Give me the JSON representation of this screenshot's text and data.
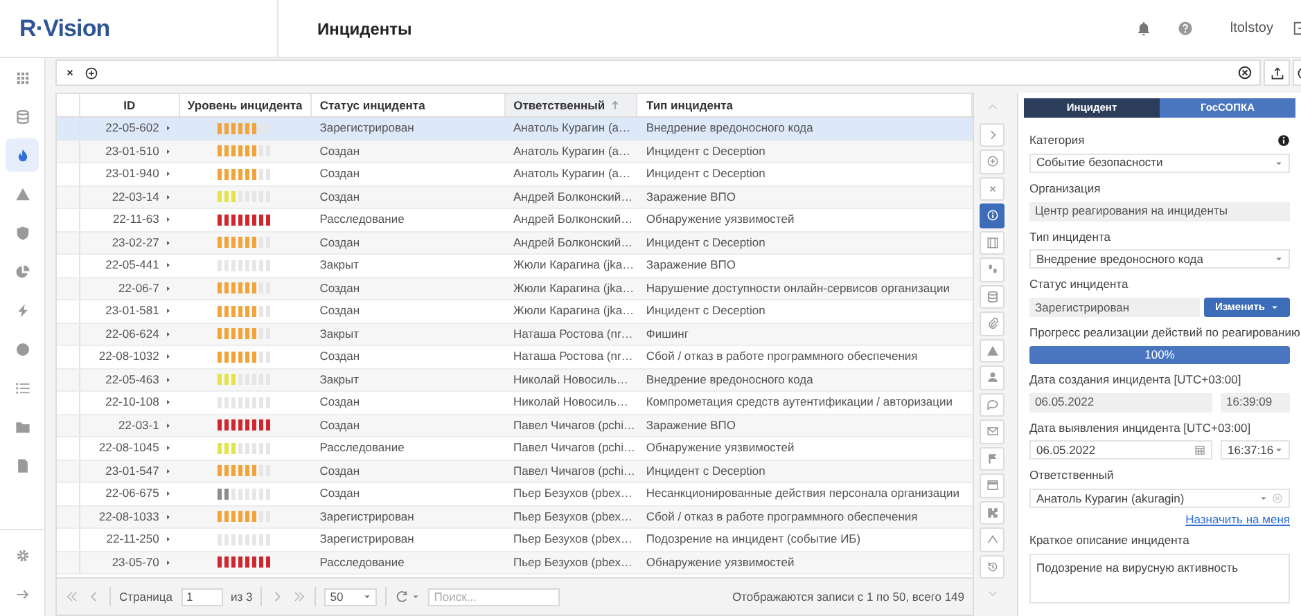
{
  "header": {
    "logo": "R·Vision",
    "title": "Инциденты",
    "user": "ltolstoy"
  },
  "sidebar": {
    "items": [
      {
        "kind": "grid",
        "selected": false
      },
      {
        "kind": "database",
        "selected": false
      },
      {
        "kind": "flame",
        "selected": true
      },
      {
        "kind": "warning",
        "selected": false
      },
      {
        "kind": "shield",
        "selected": false
      },
      {
        "kind": "pie",
        "selected": false
      },
      {
        "kind": "bolt",
        "selected": false
      },
      {
        "kind": "alert",
        "selected": false
      },
      {
        "kind": "list",
        "selected": false
      },
      {
        "kind": "folder",
        "selected": false
      },
      {
        "kind": "document",
        "selected": false
      }
    ],
    "bottom_items": [
      {
        "kind": "gear",
        "selected": false
      },
      {
        "kind": "arrow",
        "selected": false
      }
    ]
  },
  "table": {
    "columns": [
      {
        "label": "ID",
        "sorted": false
      },
      {
        "label": "Уровень инцидента",
        "sorted": false
      },
      {
        "label": "Статус инцидента",
        "sorted": false
      },
      {
        "label": "Ответственный",
        "sorted": true
      },
      {
        "label": "Тип инцидента",
        "sorted": false
      }
    ],
    "rows": [
      {
        "id": "22-05-602",
        "level": 0.75,
        "color": "#f2a33a",
        "status": "Зарегистрирован",
        "owner": "Анатоль Курагин (а…",
        "type": "Внедрение вредоносного кода",
        "selected": true
      },
      {
        "id": "23-01-510",
        "level": 0.75,
        "color": "#f2a33a",
        "status": "Создан",
        "owner": "Анатоль Курагин (а…",
        "type": "Инцидент с Deception",
        "selected": false
      },
      {
        "id": "23-01-940",
        "level": 0.75,
        "color": "#f2a33a",
        "status": "Создан",
        "owner": "Анатоль Курагин (а…",
        "type": "Инцидент с Deception",
        "selected": false
      },
      {
        "id": "22-03-14",
        "level": 0.375,
        "color": "#e3e34a",
        "status": "Создан",
        "owner": "Андрей Болконский…",
        "type": "Заражение ВПО",
        "selected": false
      },
      {
        "id": "22-11-63",
        "level": 1,
        "color": "#d0262e",
        "status": "Расследование",
        "owner": "Андрей Болконский…",
        "type": "Обнаружение уязвимостей",
        "selected": false
      },
      {
        "id": "23-02-27",
        "level": 0.75,
        "color": "#f2a33a",
        "status": "Создан",
        "owner": "Андрей Болконский…",
        "type": "Инцидент с Deception",
        "selected": false
      },
      {
        "id": "22-05-441",
        "level": 0,
        "status": "Закрыт",
        "owner": "Жюли Карагина (jka…",
        "type": "Заражение ВПО",
        "selected": false
      },
      {
        "id": "22-06-7",
        "level": 0.75,
        "color": "#f2a33a",
        "status": "Создан",
        "owner": "Жюли Карагина (jka…",
        "type": "Нарушение доступности онлайн-сервисов организации",
        "selected": false
      },
      {
        "id": "23-01-581",
        "level": 0.75,
        "color": "#f2a33a",
        "status": "Создан",
        "owner": "Жюли Карагина (jka…",
        "type": "Инцидент с Deception",
        "selected": false
      },
      {
        "id": "22-06-624",
        "level": 0.75,
        "color": "#f2a33a",
        "status": "Закрыт",
        "owner": "Наташа Ростова (nr…",
        "type": "Фишинг",
        "selected": false
      },
      {
        "id": "22-08-1032",
        "level": 0.75,
        "color": "#f2a33a",
        "status": "Создан",
        "owner": "Наташа Ростова (nr…",
        "type": "Сбой / отказ в работе программного обеспечения",
        "selected": false
      },
      {
        "id": "22-05-463",
        "level": 0.375,
        "color": "#e3e34a",
        "status": "Закрыт",
        "owner": "Николай Новосиль…",
        "type": "Внедрение вредоносного кода",
        "selected": false
      },
      {
        "id": "22-10-108",
        "level": 0,
        "status": "Создан",
        "owner": "Николай Новосиль…",
        "type": "Компрометация средств аутентификации / авторизации",
        "selected": false
      },
      {
        "id": "22-03-1",
        "level": 1,
        "color": "#d0262e",
        "status": "Создан",
        "owner": "Павел Чичагов (pchi…",
        "type": "Заражение ВПО",
        "selected": false
      },
      {
        "id": "22-08-1045",
        "level": 0.375,
        "color": "#e3e34a",
        "status": "Расследование",
        "owner": "Павел Чичагов (pchi…",
        "type": "Обнаружение уязвимостей",
        "selected": false
      },
      {
        "id": "23-01-547",
        "level": 0.75,
        "color": "#f2a33a",
        "status": "Создан",
        "owner": "Павел Чичагов (pchi…",
        "type": "Инцидент с Deception",
        "selected": false
      },
      {
        "id": "22-06-675",
        "level": 0.25,
        "color": "#8c8c8c",
        "status": "Создан",
        "owner": "Пьер Безухов (pbex…",
        "type": "Несанкционированные действия персонала организации",
        "selected": false
      },
      {
        "id": "22-08-1033",
        "level": 0.75,
        "color": "#f2a33a",
        "status": "Зарегистрирован",
        "owner": "Пьер Безухов (pbex…",
        "type": "Сбой / отказ в работе программного обеспечения",
        "selected": false
      },
      {
        "id": "22-11-250",
        "level": 0,
        "status": "Зарегистрирован",
        "owner": "Пьер Безухов (pbex…",
        "type": "Подозрение на инцидент (событие ИБ)",
        "selected": false
      },
      {
        "id": "23-05-70",
        "level": 1,
        "color": "#d0262e",
        "status": "Расследование",
        "owner": "Пьер Безухов (pbex…",
        "type": "Обнаружение уязвимостей",
        "selected": false
      }
    ]
  },
  "pagination": {
    "page_label": "Страница",
    "page": "1",
    "page_count": "из 3",
    "page_size": "50",
    "search_placeholder": "Поиск...",
    "summary": "Отображаются записи с 1 по 50, всего 149"
  },
  "tools": [
    {
      "kind": "chevron-up",
      "selected": false
    },
    {
      "kind": "chevron-right",
      "selected": false
    },
    {
      "kind": "plus-circle",
      "selected": false
    },
    {
      "kind": "close",
      "selected": false
    },
    {
      "kind": "info",
      "selected": true
    },
    {
      "kind": "film",
      "selected": false
    },
    {
      "kind": "footprints",
      "selected": false
    },
    {
      "kind": "database",
      "selected": false
    },
    {
      "kind": "paperclip",
      "selected": false
    },
    {
      "kind": "warning",
      "selected": false
    },
    {
      "kind": "user",
      "selected": false
    },
    {
      "kind": "chat",
      "selected": false
    },
    {
      "kind": "mail",
      "selected": false
    },
    {
      "kind": "flag",
      "selected": false
    },
    {
      "kind": "window",
      "selected": false
    },
    {
      "kind": "puzzle",
      "selected": false
    },
    {
      "kind": "share",
      "selected": false
    },
    {
      "kind": "history",
      "selected": false
    },
    {
      "kind": "chevron-down",
      "selected": false
    }
  ],
  "panel": {
    "tabs": [
      {
        "label": "Инцидент",
        "selected": true
      },
      {
        "label": "ГосСОПКА",
        "selected": false
      }
    ],
    "fields": [
      {
        "kind": "select",
        "label": "Категория",
        "value": "Событие безопасности",
        "has_info": true
      },
      {
        "kind": "readonly",
        "label": "Организация",
        "value": "Центр реагирования на инциденты"
      },
      {
        "kind": "select",
        "label": "Тип инцидента",
        "value": "Внедрение вредоносного кода"
      },
      {
        "kind": "status",
        "label": "Статус инцидента",
        "value": "Зарегистрирован",
        "button": "Изменить"
      },
      {
        "kind": "progress",
        "label": "Прогресс реализации действий по реагированию",
        "level": 1,
        "reading": "100%"
      },
      {
        "kind": "datetime",
        "label": "Дата создания инцидента [UTC+03:00]",
        "date": "06.05.2022",
        "time": "16:39:09"
      },
      {
        "kind": "datepicker",
        "label": "Дата выявления инцидента [UTC+03:00]",
        "date": "06.05.2022",
        "time": "16:37:16"
      },
      {
        "kind": "user-select",
        "label": "Ответственный",
        "value": "Анатоль Курагин (akuragin)",
        "link": "Назначить на меня"
      },
      {
        "kind": "textarea",
        "label": "Краткое описание инцидента",
        "value": "Подозрение на вирусную активность"
      }
    ]
  }
}
